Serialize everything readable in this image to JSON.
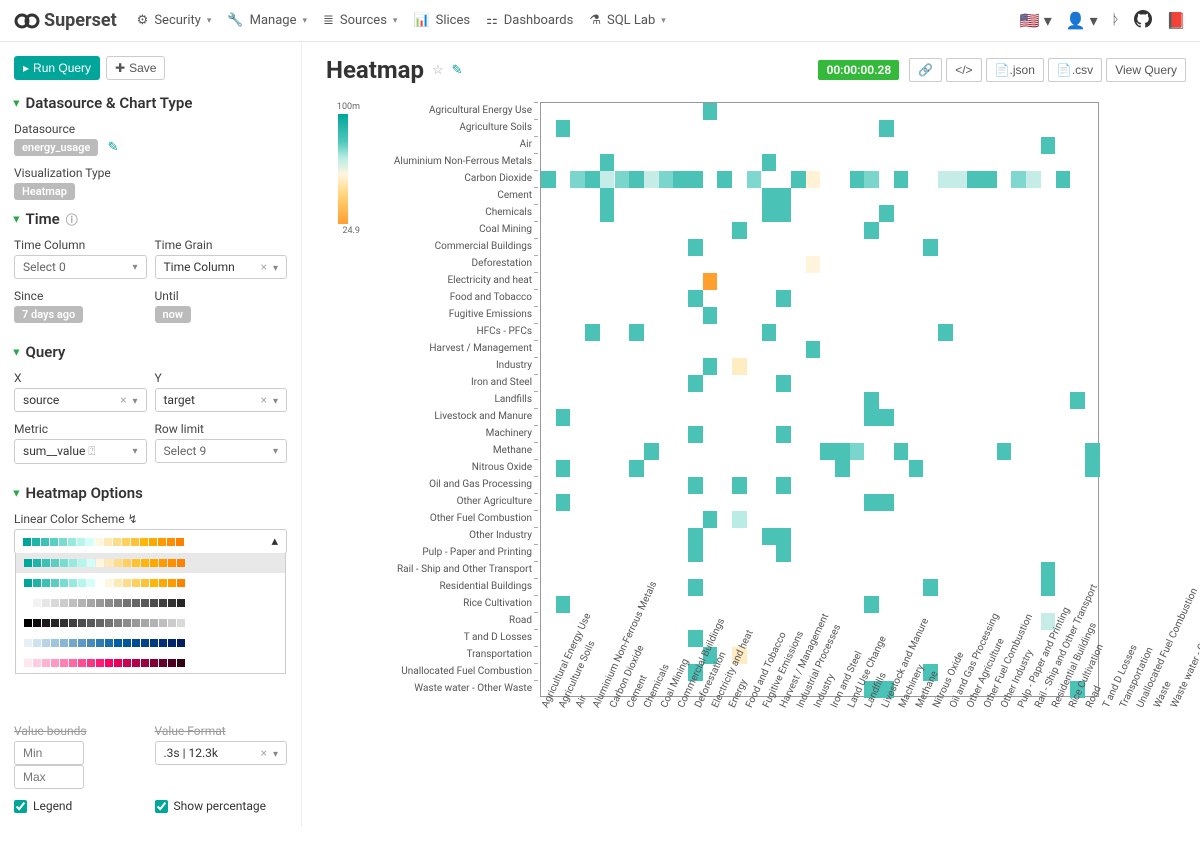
{
  "nav": {
    "brand": "Superset",
    "items": [
      {
        "label": "Security",
        "icon": "security"
      },
      {
        "label": "Manage",
        "icon": "wrench"
      },
      {
        "label": "Sources",
        "icon": "database"
      },
      {
        "label": "Slices",
        "icon": "chart"
      },
      {
        "label": "Dashboards",
        "icon": "dashboard"
      },
      {
        "label": "SQL Lab",
        "icon": "flask"
      }
    ],
    "locale": "en-US"
  },
  "buttons": {
    "run_query": "Run Query",
    "save": "Save"
  },
  "panels": {
    "datasource": {
      "title": "Datasource & Chart Type",
      "datasource_label": "Datasource",
      "datasource_value": "energy_usage",
      "viz_label": "Visualization Type",
      "viz_value": "Heatmap"
    },
    "time": {
      "title": "Time",
      "time_column_label": "Time Column",
      "time_column_value": "Select 0",
      "time_grain_label": "Time Grain",
      "time_grain_value": "Time Column",
      "since_label": "Since",
      "since_value": "7 days ago",
      "until_label": "Until",
      "until_value": "now"
    },
    "query": {
      "title": "Query",
      "x_label": "X",
      "x_value": "source",
      "y_label": "Y",
      "y_value": "target",
      "metric_label": "Metric",
      "metric_value": "sum__value",
      "rowlimit_label": "Row limit",
      "rowlimit_value": "Select 9"
    },
    "heatmap": {
      "title": "Heatmap Options",
      "linear_color_label": "Linear Color Scheme",
      "value_bounds_label": "Value bounds",
      "min_placeholder": "Min",
      "max_placeholder": "Max",
      "value_format_label": "Value Format",
      "value_format_value": ".3s | 12.3k",
      "legend_label": "Legend",
      "show_percentage_label": "Show percentage"
    }
  },
  "chart": {
    "title": "Heatmap",
    "timer": "00:00:00.28",
    "actions": {
      "json": ".json",
      "csv": ".csv",
      "view_query": "View Query"
    }
  },
  "palettes": [
    [
      "#00a699",
      "#1eb4a7",
      "#3cc1b5",
      "#5acec3",
      "#78dcD1",
      "#96e9de",
      "#b4f6ec",
      "#d2fff9",
      "#fff6e0",
      "#ffe9b5",
      "#ffdc8a",
      "#ffcf5f",
      "#ffc234",
      "#ffb509",
      "#ffa800",
      "#ff9b00",
      "#ff8e00",
      "#ff8100"
    ],
    [
      "#00a699",
      "#1eb4a7",
      "#3cc1b5",
      "#5acec3",
      "#78dcD1",
      "#96e9de",
      "#b4f6ec",
      "#d2fff9",
      "#ffffff",
      "#fff6e0",
      "#ffe9b5",
      "#ffdc8a",
      "#ffcf5f",
      "#ffc234",
      "#ffb509",
      "#ffa800",
      "#ff9b00",
      "#ff8100"
    ],
    [
      "#ffffff",
      "#f2f2f2",
      "#e6e6e6",
      "#d9d9d9",
      "#cccccc",
      "#bfbfbf",
      "#b3b3b3",
      "#a6a6a6",
      "#999999",
      "#8c8c8c",
      "#808080",
      "#737373",
      "#666666",
      "#595959",
      "#4d4d4d",
      "#404040",
      "#333333",
      "#262626"
    ],
    [
      "#000000",
      "#0d0d0d",
      "#1a1a1a",
      "#262626",
      "#333333",
      "#404040",
      "#4d4d4d",
      "#595959",
      "#666666",
      "#737373",
      "#808080",
      "#8c8c8c",
      "#999999",
      "#a6a6a6",
      "#b3b3b3",
      "#bfbfbf",
      "#cccccc",
      "#d9d9d9"
    ],
    [
      "#e6f0f7",
      "#cfe2ef",
      "#b8d3e6",
      "#a1c5de",
      "#8ab6d6",
      "#73a8cd",
      "#5c99c5",
      "#458bbc",
      "#2e7cb4",
      "#176eab",
      "#005fa3",
      "#00569a",
      "#004c91",
      "#004388",
      "#003a7f",
      "#003076",
      "#00276d",
      "#001d64"
    ],
    [
      "#ffe6f0",
      "#ffcce0",
      "#ffb3d1",
      "#ff99c2",
      "#ff80b3",
      "#ff66a3",
      "#ff4d94",
      "#ff3385",
      "#ff1a75",
      "#ff0066",
      "#e6005c",
      "#cc0052",
      "#b30047",
      "#99003d",
      "#800033",
      "#660029",
      "#4d001f",
      "#330014"
    ]
  ],
  "chart_data": {
    "type": "heatmap",
    "legend_min": "24.9",
    "legend_max": "100m",
    "y_categories": [
      "Agricultural Energy Use",
      "Agriculture Soils",
      "Air",
      "Aluminium Non-Ferrous Metals",
      "Carbon Dioxide",
      "Cement",
      "Chemicals",
      "Coal Mining",
      "Commercial Buildings",
      "Deforestation",
      "Electricity and heat",
      "Food and Tobacco",
      "Fugitive Emissions",
      "HFCs - PFCs",
      "Harvest / Management",
      "Industry",
      "Iron and Steel",
      "Landfills",
      "Livestock and Manure",
      "Machinery",
      "Methane",
      "Nitrous Oxide",
      "Oil and Gas Processing",
      "Other Agriculture",
      "Other Fuel Combustion",
      "Other Industry",
      "Pulp - Paper and Printing",
      "Rail - Ship and Other Transport",
      "Residential Buildings",
      "Rice Cultivation",
      "Road",
      "T and D Losses",
      "Transportation",
      "Unallocated Fuel Combustion",
      "Waste water - Other Waste"
    ],
    "x_categories": [
      "Agricultural Energy Use",
      "Agriculture Soils",
      "Air",
      "Aluminium Non-Ferrous Metals",
      "Carbon Dioxide",
      "Cement",
      "Chemicals",
      "Coal Mining",
      "Commercial Buildings",
      "Deforestation",
      "Electricity and heat",
      "Energy",
      "Food and Tobacco",
      "Fugitive Emissions",
      "Harvest / Management",
      "Industrial Processes",
      "Industry",
      "Iron and Steel",
      "Land Use Change",
      "Landfills",
      "Livestock and Manure",
      "Machinery",
      "Methane",
      "Nitrous Oxide",
      "Oil and Gas Processing",
      "Other Agriculture",
      "Other Fuel Combustion",
      "Other Industry",
      "Pulp - Paper and Printing",
      "Rail - Ship and Other Transport",
      "Residential Buildings",
      "Rice Cultivation",
      "Road",
      "T and D Losses",
      "Transportation",
      "Unallocated Fuel Combustion",
      "Waste",
      "Waste water - Other Waste"
    ],
    "cells": [
      {
        "y": 0,
        "x": 11,
        "c": "#4ac2b6"
      },
      {
        "y": 1,
        "x": 1,
        "c": "#4ac2b6"
      },
      {
        "y": 1,
        "x": 23,
        "c": "#4ac2b6"
      },
      {
        "y": 2,
        "x": 34,
        "c": "#4ac2b6"
      },
      {
        "y": 3,
        "x": 4,
        "c": "#4ac2b6"
      },
      {
        "y": 3,
        "x": 15,
        "c": "#4ac2b6"
      },
      {
        "y": 4,
        "x": 0,
        "c": "#4ac2b6"
      },
      {
        "y": 4,
        "x": 2,
        "c": "#7ad6cd"
      },
      {
        "y": 4,
        "x": 3,
        "c": "#4ac2b6"
      },
      {
        "y": 4,
        "x": 4,
        "c": "#c5ece7"
      },
      {
        "y": 4,
        "x": 5,
        "c": "#7ad6cd"
      },
      {
        "y": 4,
        "x": 6,
        "c": "#4ac2b6"
      },
      {
        "y": 4,
        "x": 7,
        "c": "#c5ece7"
      },
      {
        "y": 4,
        "x": 8,
        "c": "#7ad6cd"
      },
      {
        "y": 4,
        "x": 9,
        "c": "#4ac2b6"
      },
      {
        "y": 4,
        "x": 10,
        "c": "#4ac2b6"
      },
      {
        "y": 4,
        "x": 12,
        "c": "#4ac2b6"
      },
      {
        "y": 4,
        "x": 14,
        "c": "#7fd8cf"
      },
      {
        "y": 4,
        "x": 17,
        "c": "#4ac2b6"
      },
      {
        "y": 4,
        "x": 18,
        "c": "#fff2d5"
      },
      {
        "y": 4,
        "x": 21,
        "c": "#4ac2b6"
      },
      {
        "y": 4,
        "x": 22,
        "c": "#7ad6cd"
      },
      {
        "y": 4,
        "x": 24,
        "c": "#4ac2b6"
      },
      {
        "y": 4,
        "x": 27,
        "c": "#c5ece7"
      },
      {
        "y": 4,
        "x": 28,
        "c": "#c5ece7"
      },
      {
        "y": 4,
        "x": 29,
        "c": "#4ac2b6"
      },
      {
        "y": 4,
        "x": 30,
        "c": "#4ac2b6"
      },
      {
        "y": 4,
        "x": 32,
        "c": "#7fd8cf"
      },
      {
        "y": 4,
        "x": 33,
        "c": "#c5ece7"
      },
      {
        "y": 4,
        "x": 35,
        "c": "#4ac2b6"
      },
      {
        "y": 5,
        "x": 4,
        "c": "#4ac2b6"
      },
      {
        "y": 5,
        "x": 15,
        "c": "#4ac2b6"
      },
      {
        "y": 5,
        "x": 16,
        "c": "#4ac2b6"
      },
      {
        "y": 6,
        "x": 4,
        "c": "#4ac2b6"
      },
      {
        "y": 6,
        "x": 15,
        "c": "#4ac2b6"
      },
      {
        "y": 6,
        "x": 16,
        "c": "#4ac2b6"
      },
      {
        "y": 6,
        "x": 23,
        "c": "#4ac2b6"
      },
      {
        "y": 7,
        "x": 13,
        "c": "#4ac2b6"
      },
      {
        "y": 7,
        "x": 22,
        "c": "#4ac2b6"
      },
      {
        "y": 8,
        "x": 10,
        "c": "#4ac2b6"
      },
      {
        "y": 8,
        "x": 26,
        "c": "#4ac2b6"
      },
      {
        "y": 9,
        "x": 18,
        "c": "#fff5dc"
      },
      {
        "y": 10,
        "x": 11,
        "c": "#ff9f2e"
      },
      {
        "y": 11,
        "x": 10,
        "c": "#4ac2b6"
      },
      {
        "y": 11,
        "x": 16,
        "c": "#4ac2b6"
      },
      {
        "y": 12,
        "x": 11,
        "c": "#4ac2b6"
      },
      {
        "y": 13,
        "x": 3,
        "c": "#4ac2b6"
      },
      {
        "y": 13,
        "x": 6,
        "c": "#4ac2b6"
      },
      {
        "y": 13,
        "x": 15,
        "c": "#4ac2b6"
      },
      {
        "y": 13,
        "x": 27,
        "c": "#4ac2b6"
      },
      {
        "y": 14,
        "x": 18,
        "c": "#4ac2b6"
      },
      {
        "y": 15,
        "x": 11,
        "c": "#4ac2b6"
      },
      {
        "y": 15,
        "x": 13,
        "c": "#ffecc3"
      },
      {
        "y": 16,
        "x": 10,
        "c": "#4ac2b6"
      },
      {
        "y": 16,
        "x": 16,
        "c": "#4ac2b6"
      },
      {
        "y": 17,
        "x": 22,
        "c": "#4ac2b6"
      },
      {
        "y": 17,
        "x": 36,
        "c": "#4ac2b6"
      },
      {
        "y": 18,
        "x": 1,
        "c": "#4ac2b6"
      },
      {
        "y": 18,
        "x": 22,
        "c": "#4ac2b6"
      },
      {
        "y": 18,
        "x": 23,
        "c": "#4ac2b6"
      },
      {
        "y": 19,
        "x": 10,
        "c": "#4ac2b6"
      },
      {
        "y": 19,
        "x": 16,
        "c": "#4ac2b6"
      },
      {
        "y": 20,
        "x": 7,
        "c": "#4ac2b6"
      },
      {
        "y": 20,
        "x": 19,
        "c": "#4ac2b6"
      },
      {
        "y": 20,
        "x": 20,
        "c": "#4ac2b6"
      },
      {
        "y": 20,
        "x": 21,
        "c": "#7ad6cd"
      },
      {
        "y": 20,
        "x": 24,
        "c": "#4ac2b6"
      },
      {
        "y": 20,
        "x": 31,
        "c": "#4ac2b6"
      },
      {
        "y": 20,
        "x": 37,
        "c": "#4ac2b6"
      },
      {
        "y": 21,
        "x": 1,
        "c": "#4ac2b6"
      },
      {
        "y": 21,
        "x": 6,
        "c": "#4ac2b6"
      },
      {
        "y": 21,
        "x": 20,
        "c": "#4ac2b6"
      },
      {
        "y": 21,
        "x": 25,
        "c": "#4ac2b6"
      },
      {
        "y": 21,
        "x": 37,
        "c": "#4ac2b6"
      },
      {
        "y": 22,
        "x": 10,
        "c": "#4ac2b6"
      },
      {
        "y": 22,
        "x": 13,
        "c": "#4ac2b6"
      },
      {
        "y": 22,
        "x": 16,
        "c": "#4ac2b6"
      },
      {
        "y": 23,
        "x": 1,
        "c": "#4ac2b6"
      },
      {
        "y": 23,
        "x": 22,
        "c": "#4ac2b6"
      },
      {
        "y": 23,
        "x": 23,
        "c": "#4ac2b6"
      },
      {
        "y": 24,
        "x": 11,
        "c": "#4ac2b6"
      },
      {
        "y": 24,
        "x": 13,
        "c": "#b8ece5"
      },
      {
        "y": 25,
        "x": 10,
        "c": "#4ac2b6"
      },
      {
        "y": 25,
        "x": 15,
        "c": "#4ac2b6"
      },
      {
        "y": 25,
        "x": 16,
        "c": "#4ac2b6"
      },
      {
        "y": 26,
        "x": 10,
        "c": "#4ac2b6"
      },
      {
        "y": 26,
        "x": 16,
        "c": "#4ac2b6"
      },
      {
        "y": 27,
        "x": 34,
        "c": "#4ac2b6"
      },
      {
        "y": 28,
        "x": 10,
        "c": "#4ac2b6"
      },
      {
        "y": 28,
        "x": 26,
        "c": "#4ac2b6"
      },
      {
        "y": 28,
        "x": 34,
        "c": "#4ac2b6"
      },
      {
        "y": 29,
        "x": 1,
        "c": "#4ac2b6"
      },
      {
        "y": 29,
        "x": 22,
        "c": "#4ac2b6"
      },
      {
        "y": 30,
        "x": 34,
        "c": "#c5ece7"
      },
      {
        "y": 31,
        "x": 10,
        "c": "#4ac2b6"
      },
      {
        "y": 32,
        "x": 11,
        "c": "#4ac2b6"
      },
      {
        "y": 32,
        "x": 13,
        "c": "#ffecc3"
      },
      {
        "y": 33,
        "x": 10,
        "c": "#4ac2b6"
      },
      {
        "y": 33,
        "x": 26,
        "c": "#4ac2b6"
      },
      {
        "y": 34,
        "x": 22,
        "c": "#4ac2b6"
      },
      {
        "y": 34,
        "x": 23,
        "c": "#4ac2b6"
      },
      {
        "y": 34,
        "x": 36,
        "c": "#4ac2b6"
      }
    ]
  }
}
